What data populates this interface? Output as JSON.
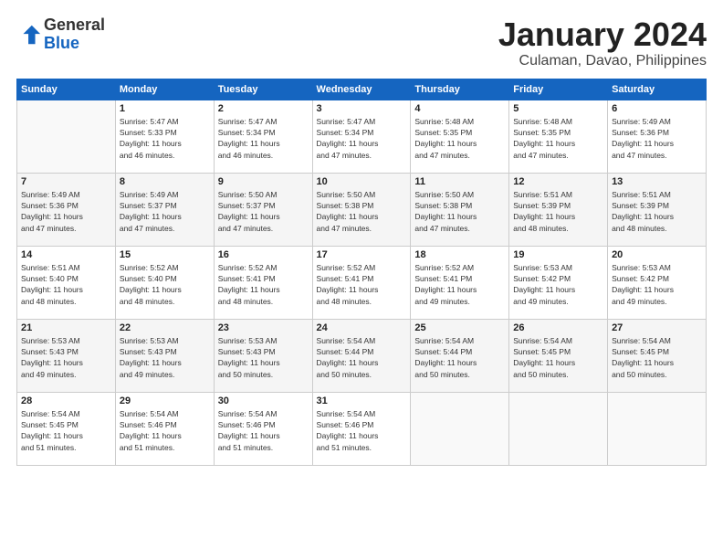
{
  "logo": {
    "general": "General",
    "blue": "Blue"
  },
  "header": {
    "month": "January 2024",
    "location": "Culaman, Davao, Philippines"
  },
  "weekdays": [
    "Sunday",
    "Monday",
    "Tuesday",
    "Wednesday",
    "Thursday",
    "Friday",
    "Saturday"
  ],
  "weeks": [
    [
      {
        "day": null,
        "info": null
      },
      {
        "day": "1",
        "info": "Sunrise: 5:47 AM\nSunset: 5:33 PM\nDaylight: 11 hours\nand 46 minutes."
      },
      {
        "day": "2",
        "info": "Sunrise: 5:47 AM\nSunset: 5:34 PM\nDaylight: 11 hours\nand 46 minutes."
      },
      {
        "day": "3",
        "info": "Sunrise: 5:47 AM\nSunset: 5:34 PM\nDaylight: 11 hours\nand 47 minutes."
      },
      {
        "day": "4",
        "info": "Sunrise: 5:48 AM\nSunset: 5:35 PM\nDaylight: 11 hours\nand 47 minutes."
      },
      {
        "day": "5",
        "info": "Sunrise: 5:48 AM\nSunset: 5:35 PM\nDaylight: 11 hours\nand 47 minutes."
      },
      {
        "day": "6",
        "info": "Sunrise: 5:49 AM\nSunset: 5:36 PM\nDaylight: 11 hours\nand 47 minutes."
      }
    ],
    [
      {
        "day": "7",
        "info": "Sunrise: 5:49 AM\nSunset: 5:36 PM\nDaylight: 11 hours\nand 47 minutes."
      },
      {
        "day": "8",
        "info": "Sunrise: 5:49 AM\nSunset: 5:37 PM\nDaylight: 11 hours\nand 47 minutes."
      },
      {
        "day": "9",
        "info": "Sunrise: 5:50 AM\nSunset: 5:37 PM\nDaylight: 11 hours\nand 47 minutes."
      },
      {
        "day": "10",
        "info": "Sunrise: 5:50 AM\nSunset: 5:38 PM\nDaylight: 11 hours\nand 47 minutes."
      },
      {
        "day": "11",
        "info": "Sunrise: 5:50 AM\nSunset: 5:38 PM\nDaylight: 11 hours\nand 47 minutes."
      },
      {
        "day": "12",
        "info": "Sunrise: 5:51 AM\nSunset: 5:39 PM\nDaylight: 11 hours\nand 48 minutes."
      },
      {
        "day": "13",
        "info": "Sunrise: 5:51 AM\nSunset: 5:39 PM\nDaylight: 11 hours\nand 48 minutes."
      }
    ],
    [
      {
        "day": "14",
        "info": "Sunrise: 5:51 AM\nSunset: 5:40 PM\nDaylight: 11 hours\nand 48 minutes."
      },
      {
        "day": "15",
        "info": "Sunrise: 5:52 AM\nSunset: 5:40 PM\nDaylight: 11 hours\nand 48 minutes."
      },
      {
        "day": "16",
        "info": "Sunrise: 5:52 AM\nSunset: 5:41 PM\nDaylight: 11 hours\nand 48 minutes."
      },
      {
        "day": "17",
        "info": "Sunrise: 5:52 AM\nSunset: 5:41 PM\nDaylight: 11 hours\nand 48 minutes."
      },
      {
        "day": "18",
        "info": "Sunrise: 5:52 AM\nSunset: 5:41 PM\nDaylight: 11 hours\nand 49 minutes."
      },
      {
        "day": "19",
        "info": "Sunrise: 5:53 AM\nSunset: 5:42 PM\nDaylight: 11 hours\nand 49 minutes."
      },
      {
        "day": "20",
        "info": "Sunrise: 5:53 AM\nSunset: 5:42 PM\nDaylight: 11 hours\nand 49 minutes."
      }
    ],
    [
      {
        "day": "21",
        "info": "Sunrise: 5:53 AM\nSunset: 5:43 PM\nDaylight: 11 hours\nand 49 minutes."
      },
      {
        "day": "22",
        "info": "Sunrise: 5:53 AM\nSunset: 5:43 PM\nDaylight: 11 hours\nand 49 minutes."
      },
      {
        "day": "23",
        "info": "Sunrise: 5:53 AM\nSunset: 5:43 PM\nDaylight: 11 hours\nand 50 minutes."
      },
      {
        "day": "24",
        "info": "Sunrise: 5:54 AM\nSunset: 5:44 PM\nDaylight: 11 hours\nand 50 minutes."
      },
      {
        "day": "25",
        "info": "Sunrise: 5:54 AM\nSunset: 5:44 PM\nDaylight: 11 hours\nand 50 minutes."
      },
      {
        "day": "26",
        "info": "Sunrise: 5:54 AM\nSunset: 5:45 PM\nDaylight: 11 hours\nand 50 minutes."
      },
      {
        "day": "27",
        "info": "Sunrise: 5:54 AM\nSunset: 5:45 PM\nDaylight: 11 hours\nand 50 minutes."
      }
    ],
    [
      {
        "day": "28",
        "info": "Sunrise: 5:54 AM\nSunset: 5:45 PM\nDaylight: 11 hours\nand 51 minutes."
      },
      {
        "day": "29",
        "info": "Sunrise: 5:54 AM\nSunset: 5:46 PM\nDaylight: 11 hours\nand 51 minutes."
      },
      {
        "day": "30",
        "info": "Sunrise: 5:54 AM\nSunset: 5:46 PM\nDaylight: 11 hours\nand 51 minutes."
      },
      {
        "day": "31",
        "info": "Sunrise: 5:54 AM\nSunset: 5:46 PM\nDaylight: 11 hours\nand 51 minutes."
      },
      {
        "day": null,
        "info": null
      },
      {
        "day": null,
        "info": null
      },
      {
        "day": null,
        "info": null
      }
    ]
  ]
}
